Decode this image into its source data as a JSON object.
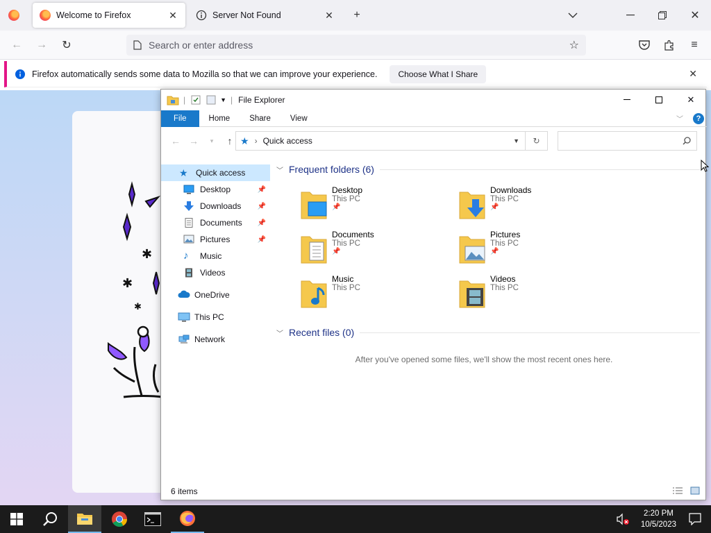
{
  "browser": {
    "tabs": [
      {
        "label": "Welcome to Firefox",
        "active": true
      },
      {
        "label": "Server Not Found",
        "active": false
      }
    ],
    "urlbar": {
      "placeholder": "Search or enter address"
    },
    "infobar": {
      "message": "Firefox automatically sends some data to Mozilla so that we can improve your experience.",
      "button": "Choose What I Share"
    }
  },
  "explorer": {
    "title": "File Explorer",
    "ribbon_tabs": [
      "File",
      "Home",
      "Share",
      "View"
    ],
    "address": "Quick access",
    "sidebar": [
      {
        "label": "Quick access",
        "icon": "star-icon",
        "selected": true
      },
      {
        "label": "Desktop",
        "icon": "desktop-icon",
        "pinned": true
      },
      {
        "label": "Downloads",
        "icon": "download-arrow-icon",
        "pinned": true
      },
      {
        "label": "Documents",
        "icon": "documents-icon",
        "pinned": true
      },
      {
        "label": "Pictures",
        "icon": "pictures-icon",
        "pinned": true
      },
      {
        "label": "Music",
        "icon": "music-note-icon"
      },
      {
        "label": "Videos",
        "icon": "video-film-icon"
      },
      {
        "label": "OneDrive",
        "icon": "cloud-icon"
      },
      {
        "label": "This PC",
        "icon": "computer-icon"
      },
      {
        "label": "Network",
        "icon": "network-icon"
      }
    ],
    "frequent_header": "Frequent folders (6)",
    "folders": [
      {
        "name": "Desktop",
        "location": "This PC",
        "pinned": true,
        "overlay": "desktop"
      },
      {
        "name": "Downloads",
        "location": "This PC",
        "pinned": true,
        "overlay": "download"
      },
      {
        "name": "Documents",
        "location": "This PC",
        "pinned": true,
        "overlay": "document"
      },
      {
        "name": "Pictures",
        "location": "This PC",
        "pinned": true,
        "overlay": "picture"
      },
      {
        "name": "Music",
        "location": "This PC",
        "pinned": false,
        "overlay": "music"
      },
      {
        "name": "Videos",
        "location": "This PC",
        "pinned": false,
        "overlay": "video"
      }
    ],
    "recent_header": "Recent files (0)",
    "recent_empty": "After you've opened some files, we'll show the most recent ones here.",
    "status": "6 items"
  },
  "taskbar": {
    "time": "2:20 PM",
    "date": "10/5/2023"
  },
  "colors": {
    "accent": "#1979ca",
    "firefox_pink": "#e31587",
    "folder_yellow": "#f5c84c"
  }
}
